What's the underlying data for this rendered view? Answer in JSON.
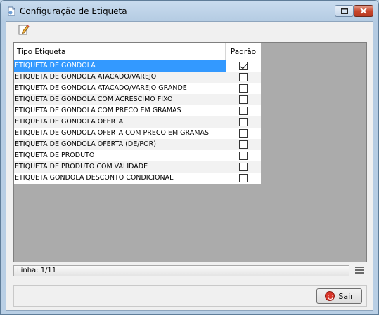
{
  "window": {
    "title": "Configuração de Etiqueta",
    "icons": {
      "app": "document-icon",
      "maximize": "maximize-icon",
      "close": "close-icon"
    }
  },
  "toolbar": {
    "edit_icon": "edit-pencil-icon"
  },
  "grid": {
    "headers": {
      "tipo": "Tipo Etiqueta",
      "padrao": "Padrão"
    },
    "rows": [
      {
        "tipo": "ETIQUETA DE GONDOLA",
        "padrao": true
      },
      {
        "tipo": "ETIQUETA DE GONDOLA ATACADO/VAREJO",
        "padrao": false
      },
      {
        "tipo": "ETIQUETA DE GONDOLA ATACADO/VAREJO GRANDE",
        "padrao": false
      },
      {
        "tipo": "ETIQUETA DE GONDOLA COM ACRESCIMO FIXO",
        "padrao": false
      },
      {
        "tipo": "ETIQUETA DE GONDOLA COM PRECO EM GRAMAS",
        "padrao": false
      },
      {
        "tipo": "ETIQUETA DE GONDOLA OFERTA",
        "padrao": false
      },
      {
        "tipo": "ETIQUETA DE GONDOLA OFERTA COM PRECO EM GRAMAS",
        "padrao": false
      },
      {
        "tipo": "ETIQUETA DE GONDOLA OFERTA (DE/POR)",
        "padrao": false
      },
      {
        "tipo": "ETIQUETA DE PRODUTO",
        "padrao": false
      },
      {
        "tipo": "ETIQUETA DE PRODUTO COM VALIDADE",
        "padrao": false
      },
      {
        "tipo": "ETIQUETA GONDOLA DESCONTO CONDICIONAL",
        "padrao": false
      }
    ],
    "selected_index": 0
  },
  "status": {
    "text": "Linha: 1/11"
  },
  "footer": {
    "sair_label": "Sair",
    "sair_icon": "power-exit-icon"
  },
  "colors": {
    "selection": "#3399ff",
    "close_button": "#c7462b",
    "exit_icon": "#d9362b"
  }
}
